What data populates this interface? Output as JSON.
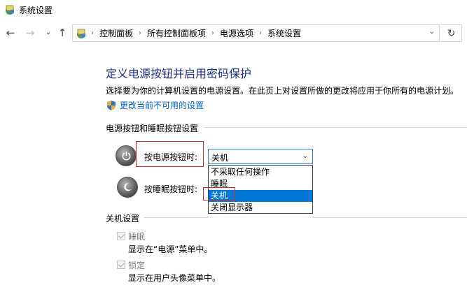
{
  "window": {
    "title": "系统设置"
  },
  "nav": {
    "breadcrumbs": [
      "控制面板",
      "所有控制面板项",
      "电源选项",
      "系统设置"
    ]
  },
  "page": {
    "title": "定义电源按钮并启用密码保护",
    "description": "选择要为你的计算机设置的电源设置。在此页上对设置所做的更改将应用于你所有的电源计划。",
    "change_link": "更改当前不可用的设置"
  },
  "buttons_section": {
    "header": "电源按钮和睡眠按钮设置",
    "power_button_label": "按电源按钮时:",
    "sleep_button_label": "按睡眠按钮时:",
    "power_button_value": "关机",
    "dropdown_options": [
      "不采取任何操作",
      "睡眠",
      "关机",
      "关闭显示器"
    ],
    "selected_option": "关机"
  },
  "shutdown_section": {
    "header": "关机设置",
    "options": [
      {
        "label": "睡眠",
        "description": "显示在“电源”菜单中。",
        "checked": true
      },
      {
        "label": "锁定",
        "description": "显示在用户头像菜单中。",
        "checked": true
      }
    ]
  },
  "colors": {
    "title_blue": "#1e3287",
    "link_blue": "#0066cc",
    "selection_blue": "#0078d7",
    "highlight_red": "#d82c2c"
  }
}
